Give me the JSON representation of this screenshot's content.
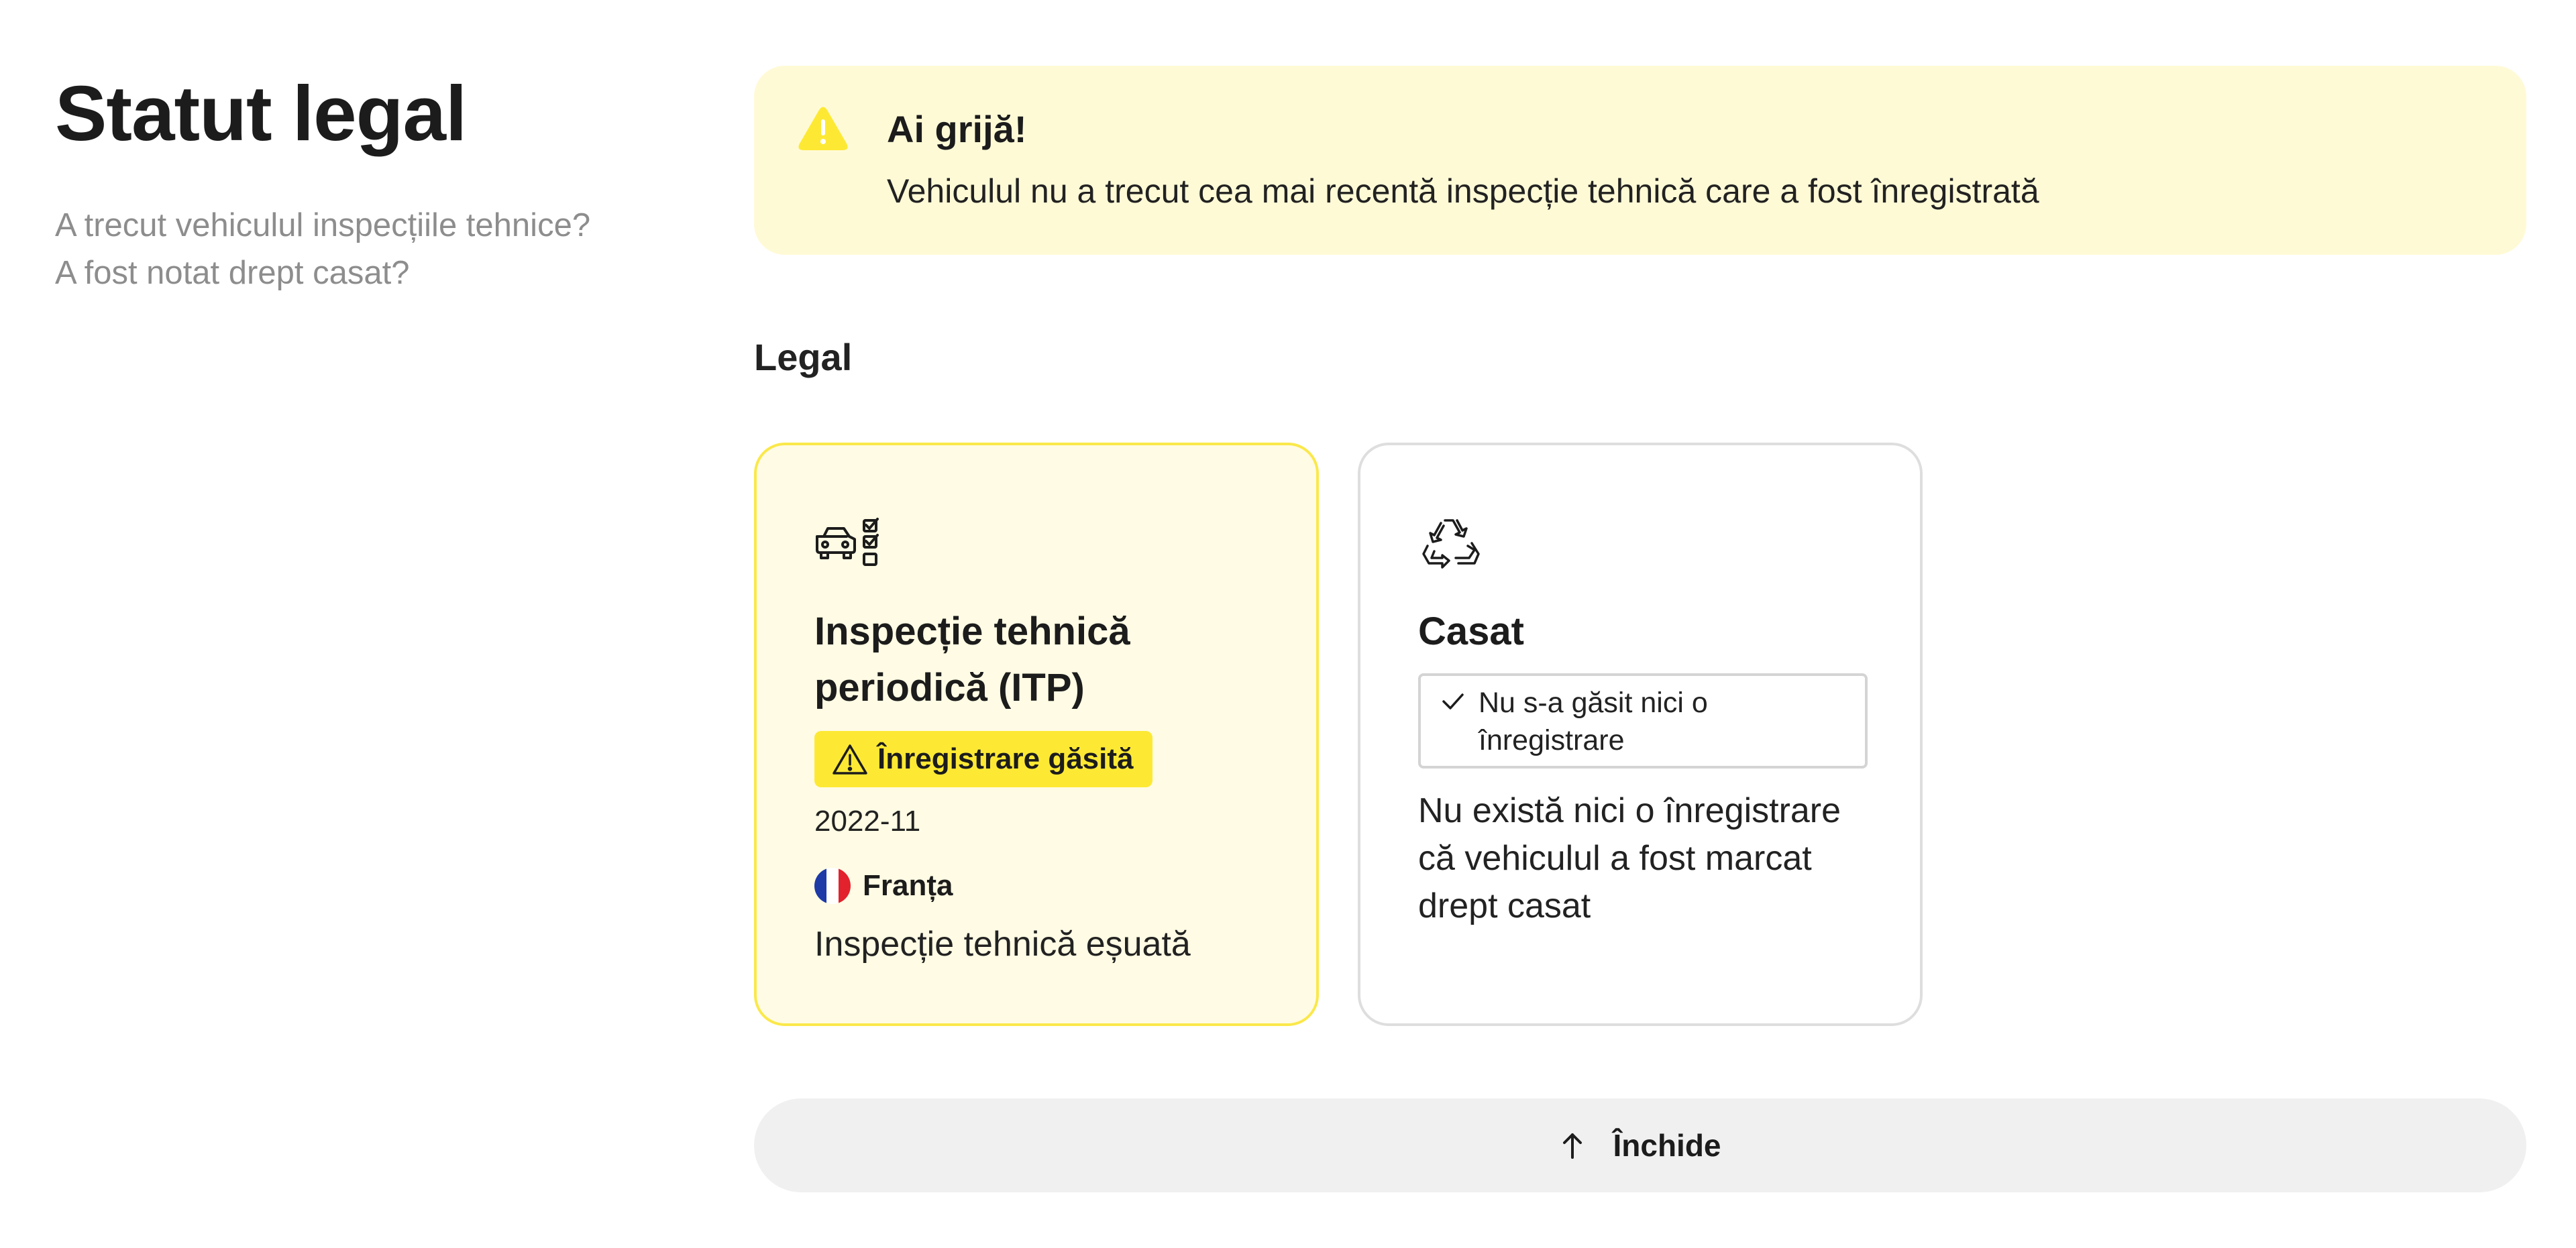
{
  "header": {
    "title": "Statut legal",
    "subtitle_lines": [
      "A trecut vehiculul inspecțiile tehnice?",
      "A fost notat drept casat?"
    ]
  },
  "alert": {
    "icon": "warning-triangle-icon",
    "title": "Ai grijă!",
    "message": "Vehiculul nu a trecut cea mai recentă inspecție tehnică care a fost înregistrată",
    "background": "#fffad6",
    "icon_color": "#fde934"
  },
  "section": {
    "heading": "Legal"
  },
  "cards": {
    "itp": {
      "icon": "car-checklist-icon",
      "title": "Inspecție tehnică periodică (ITP)",
      "badge": "Înregistrare găsită",
      "badge_icon": "warning-triangle-icon",
      "badge_color": "#fde934",
      "date": "2022-11",
      "country": "Franța",
      "country_flag": "france-flag-icon",
      "result": "Inspecție tehnică eșuată"
    },
    "casat": {
      "icon": "recycle-icon",
      "title": "Casat",
      "badge": "Nu s-a găsit nici o înregistrare",
      "badge_icon": "checkmark-icon",
      "description": "Nu există nici o înregistrare că vehiculul a fost marcat drept casat"
    }
  },
  "close_button": {
    "label": "Închide",
    "icon": "arrow-up-icon"
  }
}
